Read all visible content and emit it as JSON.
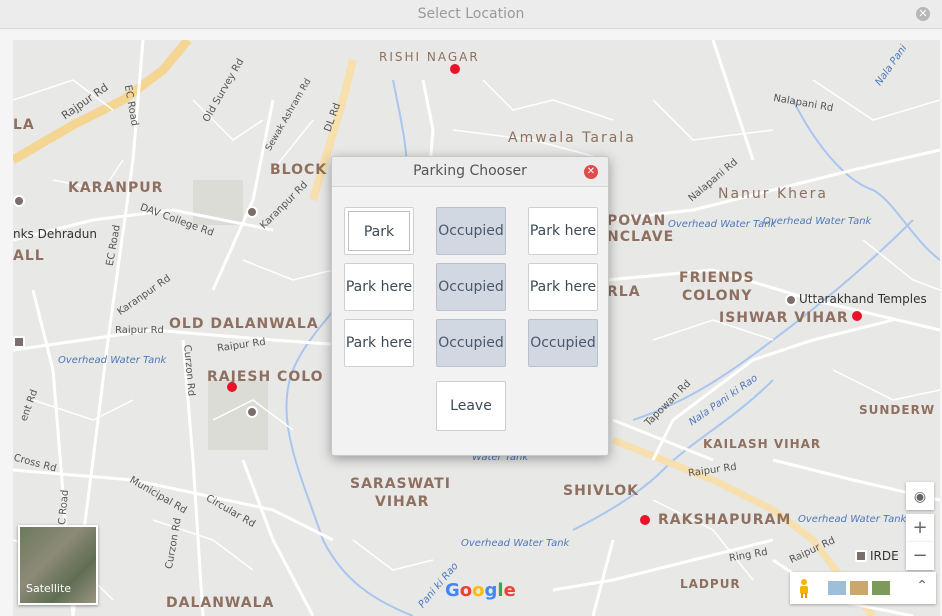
{
  "window": {
    "title": "Select Location",
    "close_icon": "close-icon"
  },
  "map": {
    "areas": [
      "RISHI NAGAR",
      "Amwala Tarala",
      "BLOCK",
      "KARANPUR",
      "Nanur Khera",
      "FRIENDS",
      "COLONY",
      "ISHWAR VIHAR",
      "OLD DALANWALA",
      "RAJESH COLO",
      "SARASWATI",
      "VIHAR",
      "SHIVLOK",
      "RAKSHAPURAM",
      "KAILASH VIHAR",
      "SUNDERW",
      "DALANWALA",
      "LADPUR",
      "LA",
      "ALL",
      "POVAN",
      "NCLAVE",
      "RLA"
    ],
    "roads": [
      "Rajpur Rd",
      "EC Road",
      "Old Survey Rd",
      "Sewak Ashram Rd",
      "DL Rd",
      "DAV College Rd",
      "Karanpur Rd",
      "EC Road",
      "Karanpur Rd",
      "Raipur Rd",
      "Curzon Rd",
      "Raipur Rd",
      "Nalapani Rd",
      "Nalapani Rd",
      "Tapowan Rd",
      "Nala Pani ki Rao",
      "Raipur Rd",
      "Municipal Rd",
      "Circular Rd",
      "Curzon Rd",
      "Cross Rd",
      "ent Rd",
      "EC Road",
      "Ring Rd",
      "Raipur Rd",
      "Pani ki Rao",
      "Nala Pani"
    ],
    "water": [
      "Overhead Water Tank",
      "Overhead Water Tank",
      "Overhead Water Tank",
      "Overhead Water Tank",
      "Overhead Water Tank",
      "Water Tank"
    ],
    "pois": [
      "Uttarakhand Temples",
      "IRDE",
      "nks Dehradun",
      "Ri",
      "ad"
    ],
    "satellite_label": "Satellite",
    "logo": "Google",
    "zoom_in": "+",
    "zoom_out": "−",
    "collapse": "⌃",
    "pin_color": "#e8142b"
  },
  "dialog": {
    "title": "Parking Chooser",
    "close_icon": "close-icon",
    "slots": [
      {
        "label": "Park here",
        "status": "free"
      },
      {
        "label": "Occupied",
        "status": "occupied"
      },
      {
        "label": "Park here",
        "status": "free"
      },
      {
        "label": "Park here",
        "status": "free"
      },
      {
        "label": "Occupied",
        "status": "occupied"
      },
      {
        "label": "Park here",
        "status": "free"
      },
      {
        "label": "Park here",
        "status": "free"
      },
      {
        "label": "Occupied",
        "status": "occupied"
      },
      {
        "label": "Occupied",
        "status": "occupied"
      }
    ],
    "leave_label": "Leave",
    "occupied_color": "#d2d8e2"
  }
}
